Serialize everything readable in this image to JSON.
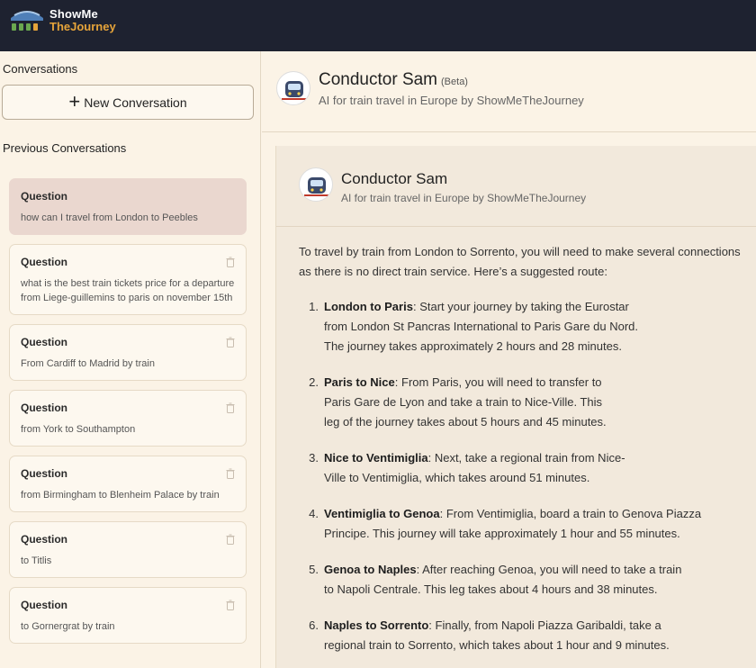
{
  "brand": {
    "line1": "ShowMe",
    "line2": "TheJourney"
  },
  "sidebar": {
    "conversations_label": "Conversations",
    "new_conversation_label": "New Conversation",
    "previous_label": "Previous Conversations",
    "items": [
      {
        "heading": "Question",
        "text": "how can I travel from London to Peebles",
        "active": true
      },
      {
        "heading": "Question",
        "text": "what is the best train tickets price for a departure from Liege-guillemins to paris on november 15th",
        "active": false
      },
      {
        "heading": "Question",
        "text": "From Cardiff to Madrid by train",
        "active": false
      },
      {
        "heading": "Question",
        "text": "from York to Southampton",
        "active": false
      },
      {
        "heading": "Question",
        "text": "from Birmingham to Blenheim Palace by train",
        "active": false
      },
      {
        "heading": "Question",
        "text": "to Titlis",
        "active": false
      },
      {
        "heading": "Question",
        "text": "to Gornergrat by train",
        "active": false
      }
    ]
  },
  "header": {
    "name": "Conductor Sam",
    "badge": "(Beta)",
    "subtitle": "AI for train travel in Europe by ShowMeTheJourney"
  },
  "chat": {
    "name": "Conductor Sam",
    "subtitle": "AI for train travel in Europe by ShowMeTheJourney",
    "intro": "To travel by train from London to Sorrento, you will need to make several connections as there is no direct train service. Here’s a suggested route:",
    "steps": [
      {
        "num": "1.",
        "title": "London to Paris",
        "lines": [
          "Start your journey by taking the Eurostar",
          "from London St Pancras International to Paris Gare du Nord.",
          "The journey takes approximately 2 hours and 28 minutes."
        ]
      },
      {
        "num": "2.",
        "title": "Paris to Nice",
        "lines": [
          "From Paris, you will need to transfer to",
          "Paris Gare de Lyon and take a train to Nice-Ville. This",
          "leg of the journey takes about 5 hours and 45 minutes."
        ]
      },
      {
        "num": "3.",
        "title": "Nice to Ventimiglia",
        "lines": [
          "Next, take a regional train from Nice-",
          "Ville to Ventimiglia, which takes around 51 minutes."
        ]
      },
      {
        "num": "4.",
        "title": "Ventimiglia to Genoa",
        "lines": [
          "From Ventimiglia, board a train to Genova Piazza",
          "Principe. This journey will take approximately 1 hour and 55 minutes."
        ]
      },
      {
        "num": "5.",
        "title": "Genoa to Naples",
        "lines": [
          "After reaching Genoa, you will need to take a train",
          "to Napoli Centrale. This leg takes about 4 hours and 38 minutes."
        ]
      },
      {
        "num": "6.",
        "title": "Naples to Sorrento",
        "lines": [
          "Finally, from Napoli Piazza Garibaldi, take a",
          "regional train to Sorrento, which takes about 1 hour and 9 minutes."
        ]
      }
    ]
  },
  "colors": {
    "topbar": "#1e2230",
    "accent": "#e6a43a",
    "active_card": "#ead7cf",
    "background": "#fbf3e6"
  },
  "icons": {
    "logo": "train-logo-icon",
    "new": "plus-icon",
    "delete": "trash-icon",
    "avatar": "train-avatar-icon"
  }
}
